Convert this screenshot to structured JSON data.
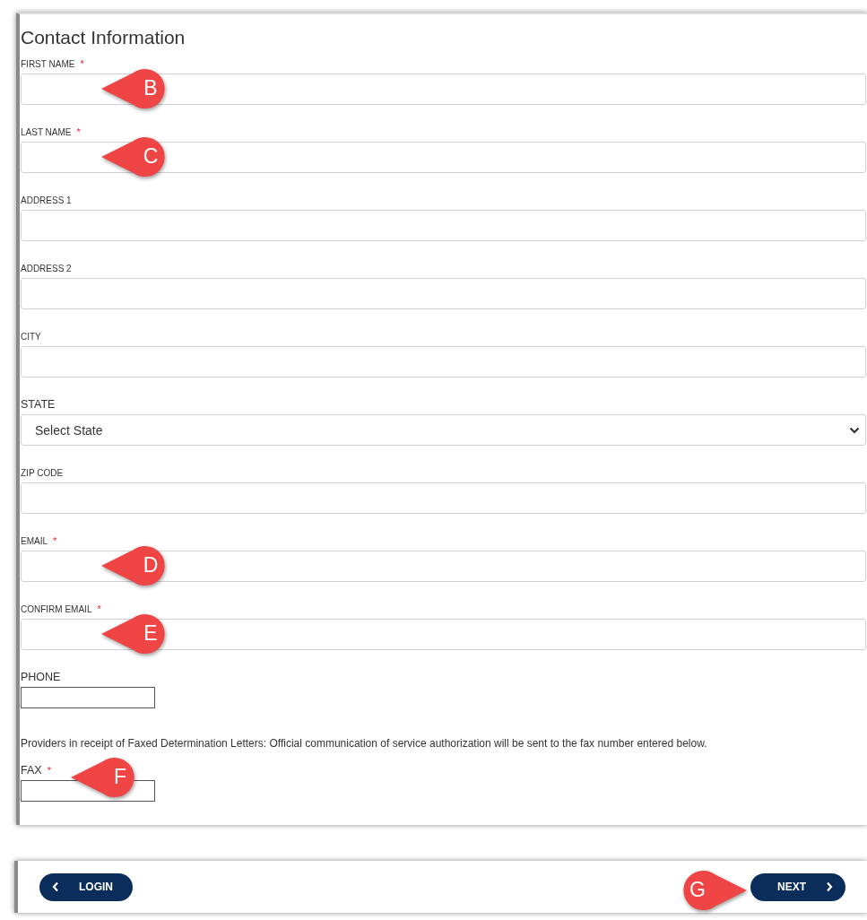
{
  "form": {
    "title": "Contact Information",
    "fields": [
      {
        "label": "FIRST NAME",
        "required_mark": "*",
        "kind": "text",
        "callout": "B"
      },
      {
        "label": "LAST NAME",
        "required_mark": "*",
        "kind": "text",
        "callout": "C"
      },
      {
        "label": "ADDRESS 1",
        "kind": "text"
      },
      {
        "label": "ADDRESS 2",
        "kind": "text"
      },
      {
        "label": "CITY",
        "kind": "text"
      },
      {
        "label": "STATE",
        "kind": "select",
        "value": "Select State"
      },
      {
        "label": "ZIP CODE",
        "kind": "text"
      },
      {
        "label": "EMAIL",
        "required_mark": "*",
        "kind": "text",
        "callout": "D"
      },
      {
        "label": "CONFIRM EMAIL",
        "required_mark": "*",
        "kind": "text",
        "callout": "E"
      },
      {
        "label": "PHONE",
        "kind": "short"
      },
      {
        "kind": "note",
        "text": "Providers in receipt of Faxed Determination Letters: Official communication of service authorization will be sent to the fax number entered below."
      },
      {
        "label": "FAX",
        "required_mark": "*",
        "kind": "short",
        "callout": "F"
      }
    ]
  },
  "footer": {
    "back_button": "LOGIN",
    "next_button": "NEXT",
    "callout": "G"
  }
}
